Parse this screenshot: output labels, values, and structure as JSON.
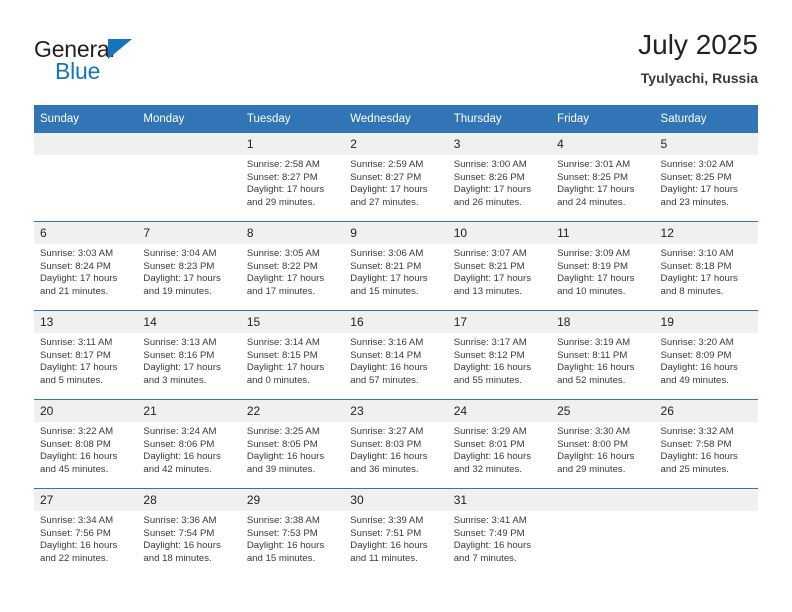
{
  "brand": {
    "name_part1": "General",
    "name_part2": "Blue",
    "triangle_color": "#1574bb"
  },
  "header": {
    "title": "July 2025",
    "location": "Tyulyachi, Russia"
  },
  "theme": {
    "header_blue": "#3275b6",
    "daynum_bg": "#f0f0f0",
    "text": "#3a3a3a"
  },
  "calendar": {
    "weekday_headers": [
      "Sunday",
      "Monday",
      "Tuesday",
      "Wednesday",
      "Thursday",
      "Friday",
      "Saturday"
    ],
    "weeks": [
      [
        {
          "day": "",
          "sunrise": "",
          "sunset": "",
          "daylight1": "",
          "daylight2": ""
        },
        {
          "day": "",
          "sunrise": "",
          "sunset": "",
          "daylight1": "",
          "daylight2": ""
        },
        {
          "day": "1",
          "sunrise": "Sunrise: 2:58 AM",
          "sunset": "Sunset: 8:27 PM",
          "daylight1": "Daylight: 17 hours",
          "daylight2": "and 29 minutes."
        },
        {
          "day": "2",
          "sunrise": "Sunrise: 2:59 AM",
          "sunset": "Sunset: 8:27 PM",
          "daylight1": "Daylight: 17 hours",
          "daylight2": "and 27 minutes."
        },
        {
          "day": "3",
          "sunrise": "Sunrise: 3:00 AM",
          "sunset": "Sunset: 8:26 PM",
          "daylight1": "Daylight: 17 hours",
          "daylight2": "and 26 minutes."
        },
        {
          "day": "4",
          "sunrise": "Sunrise: 3:01 AM",
          "sunset": "Sunset: 8:25 PM",
          "daylight1": "Daylight: 17 hours",
          "daylight2": "and 24 minutes."
        },
        {
          "day": "5",
          "sunrise": "Sunrise: 3:02 AM",
          "sunset": "Sunset: 8:25 PM",
          "daylight1": "Daylight: 17 hours",
          "daylight2": "and 23 minutes."
        }
      ],
      [
        {
          "day": "6",
          "sunrise": "Sunrise: 3:03 AM",
          "sunset": "Sunset: 8:24 PM",
          "daylight1": "Daylight: 17 hours",
          "daylight2": "and 21 minutes."
        },
        {
          "day": "7",
          "sunrise": "Sunrise: 3:04 AM",
          "sunset": "Sunset: 8:23 PM",
          "daylight1": "Daylight: 17 hours",
          "daylight2": "and 19 minutes."
        },
        {
          "day": "8",
          "sunrise": "Sunrise: 3:05 AM",
          "sunset": "Sunset: 8:22 PM",
          "daylight1": "Daylight: 17 hours",
          "daylight2": "and 17 minutes."
        },
        {
          "day": "9",
          "sunrise": "Sunrise: 3:06 AM",
          "sunset": "Sunset: 8:21 PM",
          "daylight1": "Daylight: 17 hours",
          "daylight2": "and 15 minutes."
        },
        {
          "day": "10",
          "sunrise": "Sunrise: 3:07 AM",
          "sunset": "Sunset: 8:21 PM",
          "daylight1": "Daylight: 17 hours",
          "daylight2": "and 13 minutes."
        },
        {
          "day": "11",
          "sunrise": "Sunrise: 3:09 AM",
          "sunset": "Sunset: 8:19 PM",
          "daylight1": "Daylight: 17 hours",
          "daylight2": "and 10 minutes."
        },
        {
          "day": "12",
          "sunrise": "Sunrise: 3:10 AM",
          "sunset": "Sunset: 8:18 PM",
          "daylight1": "Daylight: 17 hours",
          "daylight2": "and 8 minutes."
        }
      ],
      [
        {
          "day": "13",
          "sunrise": "Sunrise: 3:11 AM",
          "sunset": "Sunset: 8:17 PM",
          "daylight1": "Daylight: 17 hours",
          "daylight2": "and 5 minutes."
        },
        {
          "day": "14",
          "sunrise": "Sunrise: 3:13 AM",
          "sunset": "Sunset: 8:16 PM",
          "daylight1": "Daylight: 17 hours",
          "daylight2": "and 3 minutes."
        },
        {
          "day": "15",
          "sunrise": "Sunrise: 3:14 AM",
          "sunset": "Sunset: 8:15 PM",
          "daylight1": "Daylight: 17 hours",
          "daylight2": "and 0 minutes."
        },
        {
          "day": "16",
          "sunrise": "Sunrise: 3:16 AM",
          "sunset": "Sunset: 8:14 PM",
          "daylight1": "Daylight: 16 hours",
          "daylight2": "and 57 minutes."
        },
        {
          "day": "17",
          "sunrise": "Sunrise: 3:17 AM",
          "sunset": "Sunset: 8:12 PM",
          "daylight1": "Daylight: 16 hours",
          "daylight2": "and 55 minutes."
        },
        {
          "day": "18",
          "sunrise": "Sunrise: 3:19 AM",
          "sunset": "Sunset: 8:11 PM",
          "daylight1": "Daylight: 16 hours",
          "daylight2": "and 52 minutes."
        },
        {
          "day": "19",
          "sunrise": "Sunrise: 3:20 AM",
          "sunset": "Sunset: 8:09 PM",
          "daylight1": "Daylight: 16 hours",
          "daylight2": "and 49 minutes."
        }
      ],
      [
        {
          "day": "20",
          "sunrise": "Sunrise: 3:22 AM",
          "sunset": "Sunset: 8:08 PM",
          "daylight1": "Daylight: 16 hours",
          "daylight2": "and 45 minutes."
        },
        {
          "day": "21",
          "sunrise": "Sunrise: 3:24 AM",
          "sunset": "Sunset: 8:06 PM",
          "daylight1": "Daylight: 16 hours",
          "daylight2": "and 42 minutes."
        },
        {
          "day": "22",
          "sunrise": "Sunrise: 3:25 AM",
          "sunset": "Sunset: 8:05 PM",
          "daylight1": "Daylight: 16 hours",
          "daylight2": "and 39 minutes."
        },
        {
          "day": "23",
          "sunrise": "Sunrise: 3:27 AM",
          "sunset": "Sunset: 8:03 PM",
          "daylight1": "Daylight: 16 hours",
          "daylight2": "and 36 minutes."
        },
        {
          "day": "24",
          "sunrise": "Sunrise: 3:29 AM",
          "sunset": "Sunset: 8:01 PM",
          "daylight1": "Daylight: 16 hours",
          "daylight2": "and 32 minutes."
        },
        {
          "day": "25",
          "sunrise": "Sunrise: 3:30 AM",
          "sunset": "Sunset: 8:00 PM",
          "daylight1": "Daylight: 16 hours",
          "daylight2": "and 29 minutes."
        },
        {
          "day": "26",
          "sunrise": "Sunrise: 3:32 AM",
          "sunset": "Sunset: 7:58 PM",
          "daylight1": "Daylight: 16 hours",
          "daylight2": "and 25 minutes."
        }
      ],
      [
        {
          "day": "27",
          "sunrise": "Sunrise: 3:34 AM",
          "sunset": "Sunset: 7:56 PM",
          "daylight1": "Daylight: 16 hours",
          "daylight2": "and 22 minutes."
        },
        {
          "day": "28",
          "sunrise": "Sunrise: 3:36 AM",
          "sunset": "Sunset: 7:54 PM",
          "daylight1": "Daylight: 16 hours",
          "daylight2": "and 18 minutes."
        },
        {
          "day": "29",
          "sunrise": "Sunrise: 3:38 AM",
          "sunset": "Sunset: 7:53 PM",
          "daylight1": "Daylight: 16 hours",
          "daylight2": "and 15 minutes."
        },
        {
          "day": "30",
          "sunrise": "Sunrise: 3:39 AM",
          "sunset": "Sunset: 7:51 PM",
          "daylight1": "Daylight: 16 hours",
          "daylight2": "and 11 minutes."
        },
        {
          "day": "31",
          "sunrise": "Sunrise: 3:41 AM",
          "sunset": "Sunset: 7:49 PM",
          "daylight1": "Daylight: 16 hours",
          "daylight2": "and 7 minutes."
        },
        {
          "day": "",
          "sunrise": "",
          "sunset": "",
          "daylight1": "",
          "daylight2": ""
        },
        {
          "day": "",
          "sunrise": "",
          "sunset": "",
          "daylight1": "",
          "daylight2": ""
        }
      ]
    ]
  }
}
